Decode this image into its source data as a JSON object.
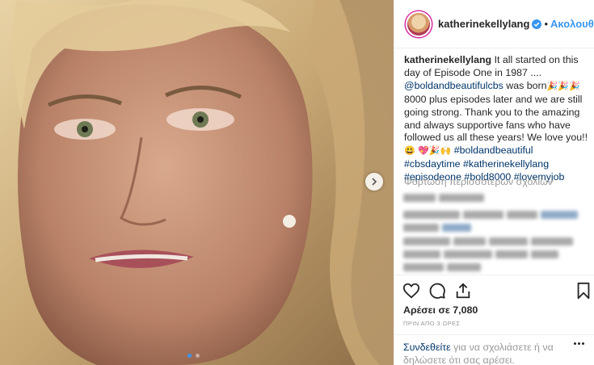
{
  "post": {
    "carousel": {
      "slide_count": 2,
      "active_slide": 1
    }
  },
  "header": {
    "username": "katherinekellylang",
    "separator": "•",
    "follow_label": "Ακολουθήστε"
  },
  "caption": {
    "username": "katherinekellylang",
    "line1": " It all started on this day of Episode One in 1987 ....",
    "mention": "@boldandbeautifulcbs",
    "line2": " was born",
    "emoji1": "🎉🎉🎉",
    "line3": " 8000 plus episodes later and we are still going strong. Thank you to the amazing and always supportive fans who have followed us all these years! We love you!!",
    "emoji2": "😃",
    "emoji3": "💖🎉🙌",
    "tags": [
      "#boldandbeautiful",
      "#cbsdaytime",
      "#katherinekellylang",
      "#episodeone",
      "#bold8000",
      "#lovemyjob"
    ]
  },
  "comments": {
    "load_more_label": "Φόρτωση περισσότερων σχολίων"
  },
  "likes": {
    "label": "Αρέσει σε 7,080"
  },
  "timestamp": "ΠΡΙΝ ΑΠΟ 3 ΩΡΕΣ",
  "login_prompt": {
    "signin_label": "Συνδεθείτε",
    "rest": " για να σχολιάσετε ή να δηλώσετε ότι σας αρέσει."
  },
  "colors": {
    "accent": "#3897f0",
    "link": "#003569",
    "muted": "#999999",
    "text": "#262626"
  },
  "icons": [
    "next-arrow-icon",
    "verified-badge-icon",
    "heart-icon",
    "comment-icon",
    "share-icon",
    "bookmark-icon",
    "more-options-icon"
  ]
}
